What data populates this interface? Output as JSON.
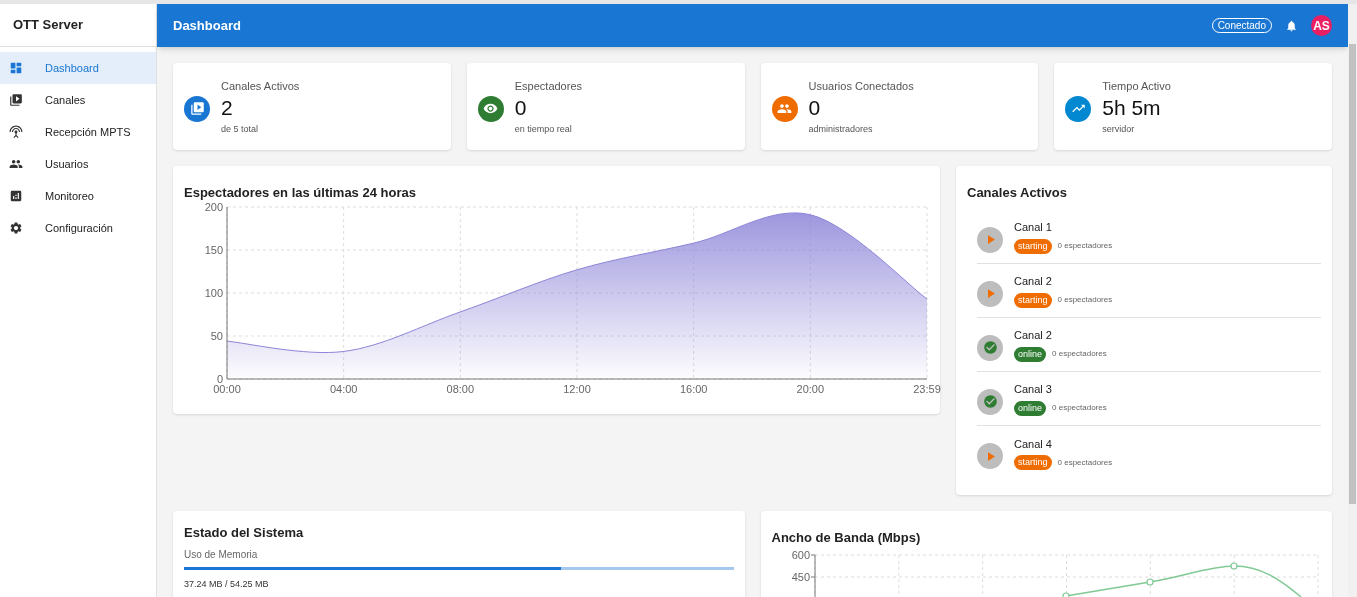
{
  "sidebar": {
    "title": "OTT Server",
    "items": [
      {
        "label": "Dashboard",
        "selected": true
      },
      {
        "label": "Canales",
        "selected": false
      },
      {
        "label": "Recepción MPTS",
        "selected": false
      },
      {
        "label": "Usuarios",
        "selected": false
      },
      {
        "label": "Monitoreo",
        "selected": false
      },
      {
        "label": "Configuración",
        "selected": false
      }
    ]
  },
  "header": {
    "title": "Dashboard",
    "status": "Conectado",
    "avatar": "AS"
  },
  "stats": [
    {
      "label": "Canales Activos",
      "value": "2",
      "caption": "de 5 total",
      "color": "#1976d2"
    },
    {
      "label": "Espectadores",
      "value": "0",
      "caption": "en tiempo real",
      "color": "#2e7d32"
    },
    {
      "label": "Usuarios Conectados",
      "value": "0",
      "caption": "administradores",
      "color": "#ef6c00"
    },
    {
      "label": "Tiempo Activo",
      "value": "5h 5m",
      "caption": "servidor",
      "color": "#0288d1"
    }
  ],
  "viewers_chart": {
    "title": "Espectadores en las últimas 24 horas",
    "chart_data": {
      "type": "area",
      "categories": [
        "00:00",
        "04:00",
        "08:00",
        "12:00",
        "16:00",
        "20:00",
        "23:59"
      ],
      "series": [
        {
          "color": "#8c84d8",
          "values": [
            44,
            32,
            78,
            127,
            158,
            191,
            93
          ]
        }
      ],
      "ylim": [
        0,
        200
      ],
      "yticks": [
        0,
        50,
        100,
        150,
        200
      ],
      "grid": true
    }
  },
  "active_channels": {
    "title": "Canales Activos",
    "items": [
      {
        "name": "Canal 1",
        "kind": "starting",
        "status": "starting",
        "viewers": "0 espectadores"
      },
      {
        "name": "Canal 2",
        "kind": "starting",
        "status": "starting",
        "viewers": "0 espectadores"
      },
      {
        "name": "Canal 2",
        "kind": "online",
        "status": "online",
        "viewers": "0 espectadores"
      },
      {
        "name": "Canal 3",
        "kind": "online",
        "status": "online",
        "viewers": "0 espectadores"
      },
      {
        "name": "Canal 4",
        "kind": "starting",
        "status": "starting",
        "viewers": "0 espectadores"
      }
    ]
  },
  "system_status": {
    "title": "Estado del Sistema",
    "memory": {
      "label": "Uso de Memoria",
      "level": 0.686,
      "reading": "37.24 MB / 54.25 MB"
    }
  },
  "bandwidth_chart": {
    "title": "Ancho de Banda (Mbps)",
    "y_tick_labels": [
      "600",
      "450"
    ]
  }
}
